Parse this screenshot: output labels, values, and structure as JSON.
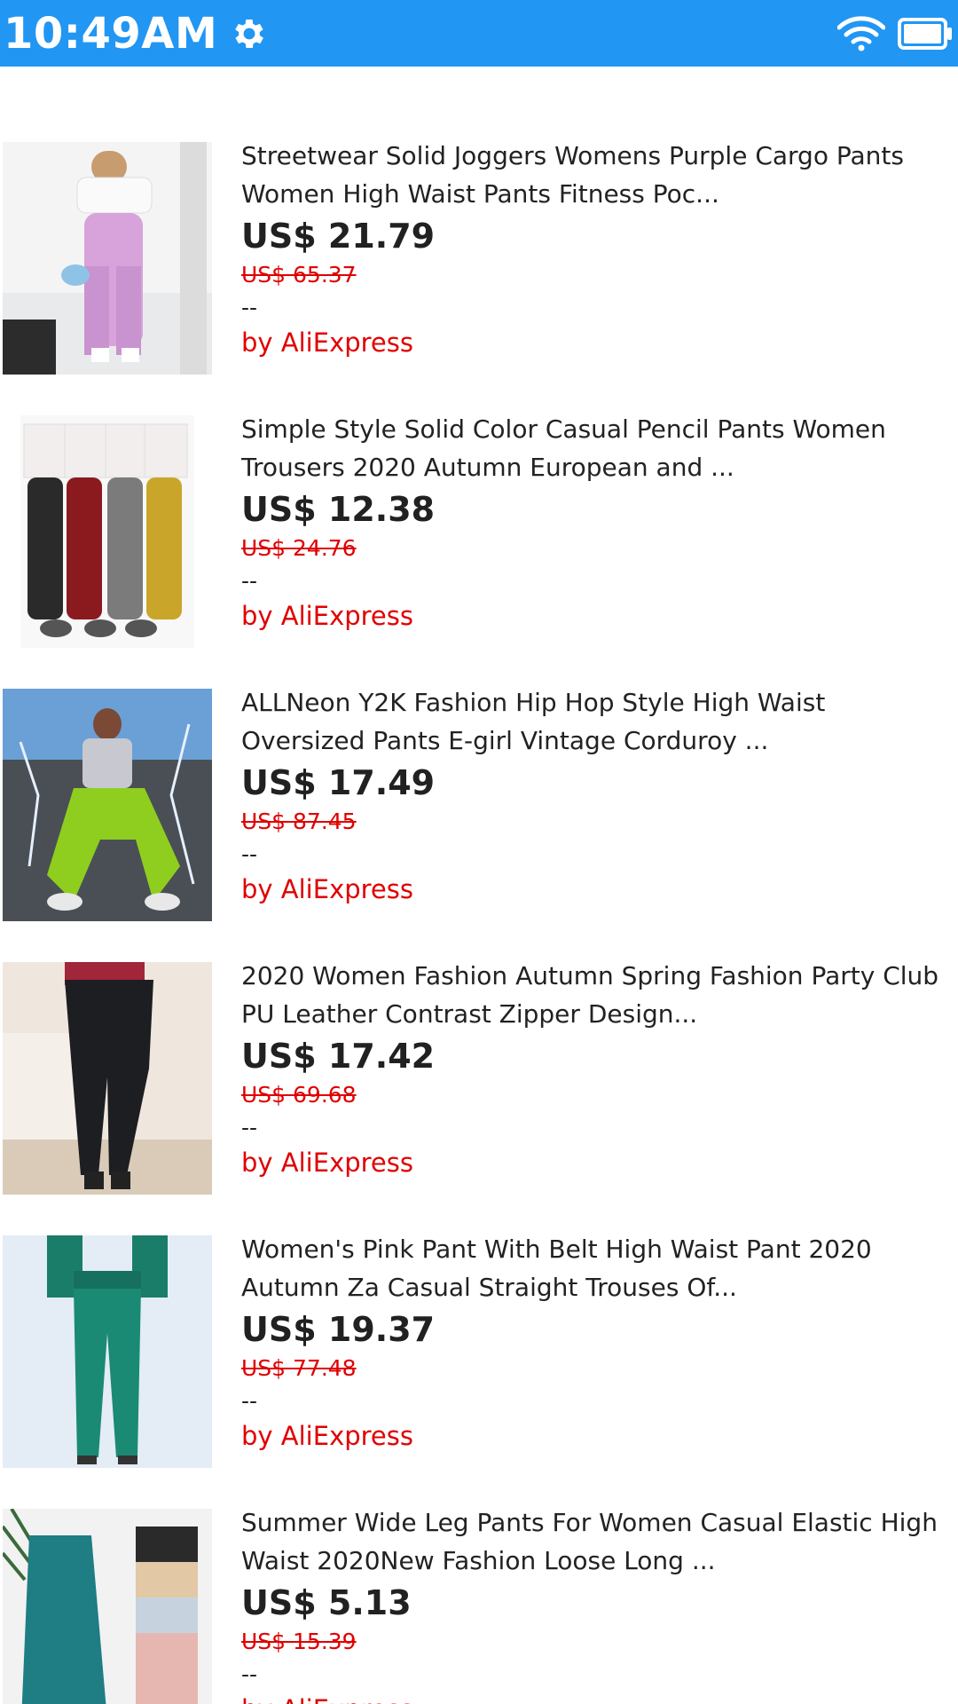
{
  "status_bar": {
    "time": "10:49AM",
    "icons": [
      "settings-gear-icon",
      "wifi-icon",
      "battery-icon"
    ],
    "background": "#2196f3"
  },
  "products": [
    {
      "title": "Streetwear Solid Joggers Womens Purple Cargo Pants Women High Waist Pants Fitness Poc...",
      "price": "US$ 21.79",
      "original_price": "US$ 65.37",
      "rating": "--",
      "seller": "by AliExpress",
      "image": "woman-lilac-cargo-pants-photo"
    },
    {
      "title": "Simple Style Solid Color Casual Pencil Pants Women Trousers 2020 Autumn European and ...",
      "price": "US$ 12.38",
      "original_price": "US$ 24.76",
      "rating": "--",
      "seller": "by AliExpress",
      "image": "four-color-jogger-pants-photo"
    },
    {
      "title": "ALLNeon Y2K Fashion Hip Hop Style High Waist Oversized Pants E-girl Vintage Corduroy ...",
      "price": "US$ 17.49",
      "original_price": "US$ 87.45",
      "rating": "--",
      "seller": "by AliExpress",
      "image": "neon-green-corduroy-pants-photo"
    },
    {
      "title": "2020 Women Fashion Autumn Spring Fashion Party Club PU Leather Contrast Zipper Design...",
      "price": "US$ 17.42",
      "original_price": "US$ 69.68",
      "rating": "--",
      "seller": "by AliExpress",
      "image": "black-leather-pants-photo"
    },
    {
      "title": "Women's Pink Pant With Belt High Waist Pant 2020 Autumn Za Casual Straight Trouses Of...",
      "price": "US$ 19.37",
      "original_price": "US$ 77.48",
      "rating": "--",
      "seller": "by AliExpress",
      "image": "green-belted-pants-photo"
    },
    {
      "title": "Summer Wide Leg Pants For Women Casual Elastic High Waist 2020New Fashion Loose Long ...",
      "price": "US$ 5.13",
      "original_price": "US$ 15.39",
      "rating": "--",
      "seller": "by AliExpress",
      "image": "teal-wide-leg-pants-photo"
    }
  ]
}
